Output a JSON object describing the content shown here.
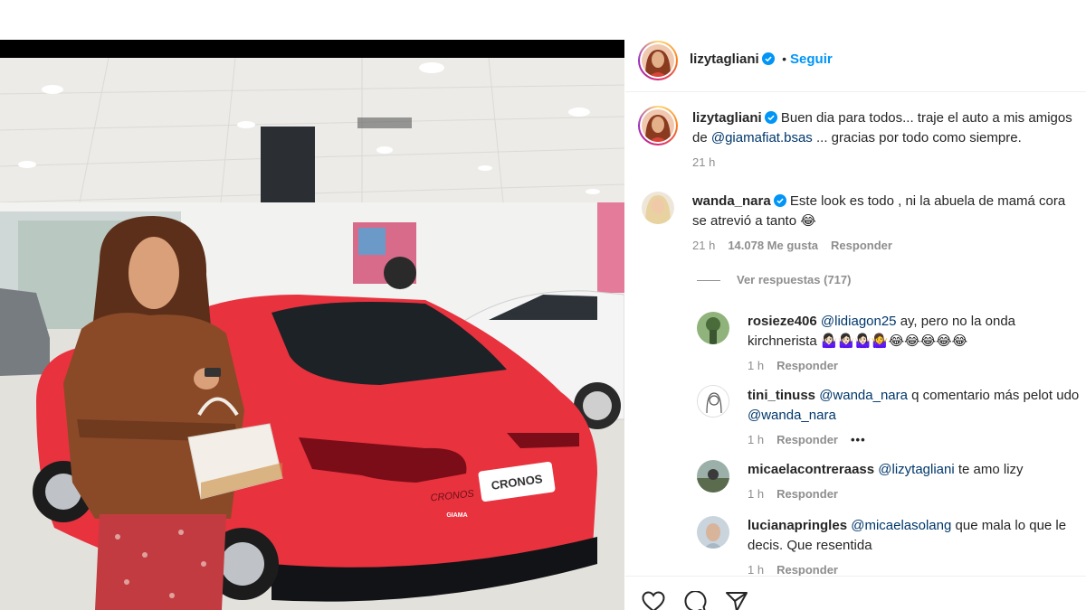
{
  "post": {
    "author": "lizytagliani",
    "follow_label": "Seguir",
    "separator": "•"
  },
  "caption": {
    "author": "lizytagliani",
    "text_part1": "Buen dia para todos... traje el auto a mis amigos",
    "text_part2_prefix": "de ",
    "mention": "@giamafiat.bsas",
    "text_part2_suffix": " ... gracias por todo como siempre.",
    "time": "21 h"
  },
  "comments": [
    {
      "author": "wanda_nara",
      "line1": "Este look es todo , ni la abuela de mamá cora",
      "line2": "se atrevió a tanto 😂",
      "time": "21 h",
      "likes": "14.078 Me gusta",
      "reply": "Responder"
    }
  ],
  "view_replies": "Ver respuestas (717)",
  "replies": [
    {
      "author": "rosieze406",
      "mention": "@lidiagon25",
      "text1": " ay, pero no la onda",
      "text2": "kirchnerista 🤷🏻‍♀️🤷🏻‍♀️🤷🏻‍♀️🤷‍♀️😂😂😂😂😂",
      "time": "1 h",
      "reply": "Responder"
    },
    {
      "author": "tini_tinuss",
      "mention": "@wanda_nara",
      "text1": " q comentario más pelot udo",
      "mention2": "@wanda_nara",
      "time": "1 h",
      "reply": "Responder",
      "more": "•••"
    },
    {
      "author": "micaelacontreraass",
      "mention": "@lizytagliani",
      "text1": " te amo lizy",
      "time": "1 h",
      "reply": "Responder"
    },
    {
      "author": "lucianapringles",
      "mention": "@micaelasolang",
      "text1": " que mala lo que le",
      "text2": "decis. Que resentida",
      "time": "1 h",
      "reply": "Responder"
    }
  ],
  "photo": {
    "plate_text": "CRONOS",
    "badge_text": "CRONOS",
    "dealer_badge": "GIAMA"
  },
  "colors": {
    "link": "#0095f6",
    "mention": "#00376b",
    "meta": "#8e8e8e",
    "verified": "#0095f6",
    "car": "#e8323e"
  },
  "icons": [
    "heart-icon",
    "comment-icon",
    "share-icon",
    "verified-icon"
  ]
}
